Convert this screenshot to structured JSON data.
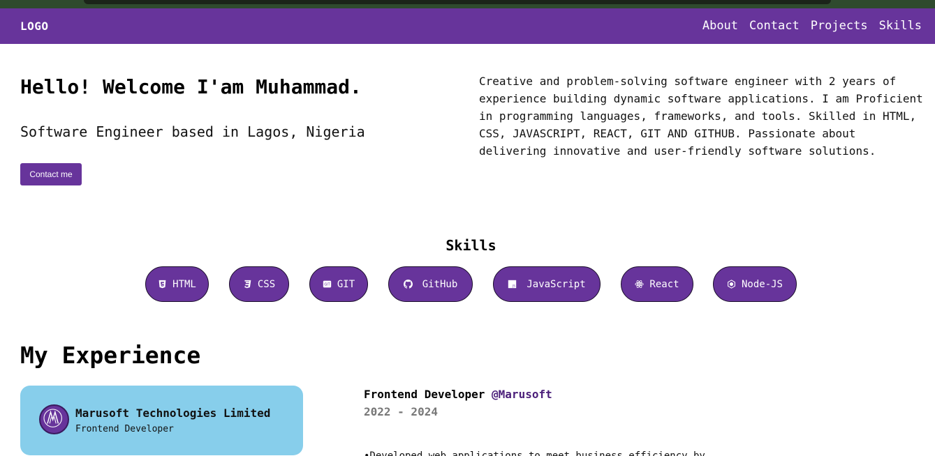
{
  "nav": {
    "logo": "LOGO",
    "links": [
      "About",
      "Contact",
      "Projects",
      "Skills"
    ]
  },
  "hero": {
    "title": "Hello! Welcome I'am Muhammad.",
    "subtitle": "Software Engineer based in Lagos, Nigeria",
    "cta_label": "Contact me",
    "description": "Creative and problem-solving software engineer with 2 years of experience building dynamic software applications. I am Proficient in programming languages, frameworks, and tools. Skilled in HTML, CSS, JAVASCRIPT, REACT, GIT AND GITHUB. Passionate about delivering innovative and user-friendly software solutions."
  },
  "skills": {
    "title": "Skills",
    "items": [
      {
        "label": "HTML",
        "icon": "html5-icon"
      },
      {
        "label": "CSS",
        "icon": "css3-icon"
      },
      {
        "label": "GIT",
        "icon": "git-icon"
      },
      {
        "label": "GitHub",
        "icon": "github-icon"
      },
      {
        "label": "JavaScript",
        "icon": "javascript-icon"
      },
      {
        "label": "React",
        "icon": "react-icon"
      },
      {
        "label": "Node-JS",
        "icon": "nodejs-icon"
      }
    ]
  },
  "experience": {
    "title": "My Experience",
    "card": {
      "company": "Marusoft Technologies Limited",
      "role": "Frontend Developer"
    },
    "job": {
      "title": "Frontend Developer ",
      "company": "@Marusoft",
      "dates": "2022 - 2024",
      "description": "•Developed web applications to meet business efficiency by"
    }
  },
  "colors": {
    "brand": "#67349b",
    "card": "#87ceeb",
    "muted": "#777777"
  }
}
